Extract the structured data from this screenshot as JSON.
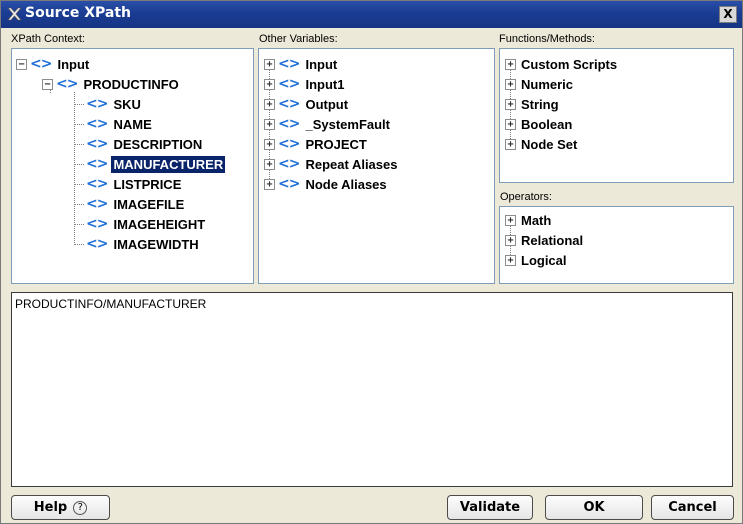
{
  "window": {
    "title": "Source XPath",
    "close_label": "X"
  },
  "xpath_context": {
    "label": "XPath Context:",
    "root": "Input",
    "child": "PRODUCTINFO",
    "fields": [
      "SKU",
      "NAME",
      "DESCRIPTION",
      "MANUFACTURER",
      "LISTPRICE",
      "IMAGEFILE",
      "IMAGEHEIGHT",
      "IMAGEWIDTH"
    ],
    "selected": "MANUFACTURER"
  },
  "other_variables": {
    "label": "Other Variables:",
    "items": [
      "Input",
      "Input1",
      "Output",
      "_SystemFault",
      "PROJECT"
    ],
    "aliases": [
      "Repeat Aliases",
      "Node Aliases"
    ]
  },
  "functions": {
    "label": "Functions/Methods:",
    "items": [
      "Custom Scripts",
      "Numeric",
      "String",
      "Boolean",
      "Node Set"
    ]
  },
  "operators": {
    "label": "Operators:",
    "items": [
      "Math",
      "Relational",
      "Logical"
    ]
  },
  "expression": {
    "value": "PRODUCTINFO/MANUFACTURER"
  },
  "buttons": {
    "help": "Help",
    "help_icon": "?",
    "validate": "Validate",
    "ok": "OK",
    "cancel": "Cancel"
  }
}
